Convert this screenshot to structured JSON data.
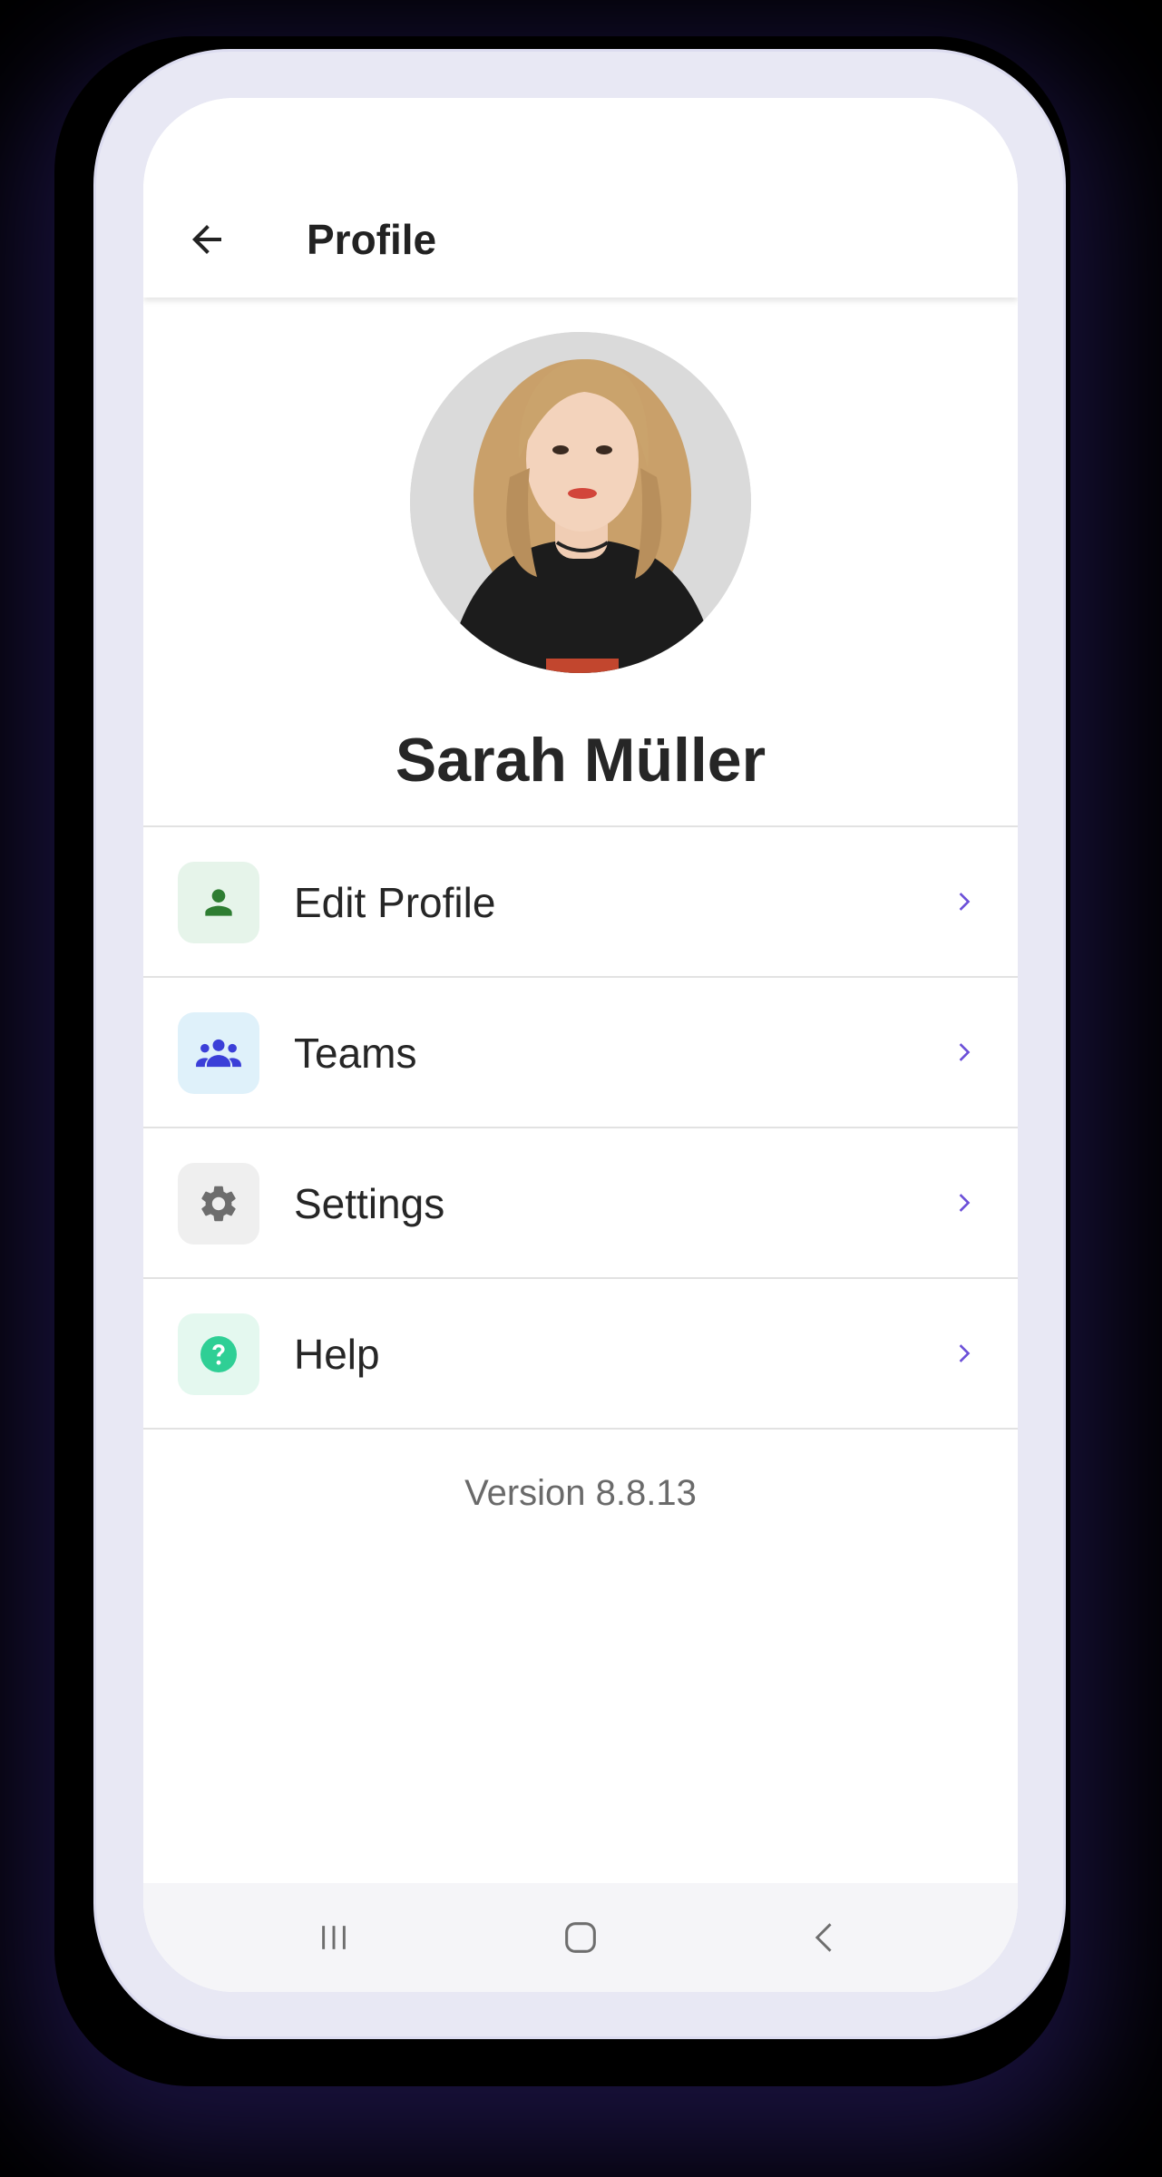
{
  "app_bar": {
    "title": "Profile",
    "back_icon": "arrow-left-icon"
  },
  "profile": {
    "name": "Sarah Müller",
    "avatar_alt": "Profile photo"
  },
  "menu": {
    "items": [
      {
        "label": "Edit Profile",
        "icon": "person-icon",
        "icon_color": "#2e7d32",
        "icon_bg": "#e6f4ea"
      },
      {
        "label": "Teams",
        "icon": "group-icon",
        "icon_color": "#3b3fd8",
        "icon_bg": "#dff1fa"
      },
      {
        "label": "Settings",
        "icon": "gear-icon",
        "icon_color": "#6d6d6d",
        "icon_bg": "#efefef"
      },
      {
        "label": "Help",
        "icon": "help-circle-icon",
        "icon_color": "#2fcf95",
        "icon_bg": "#e4f8ef"
      }
    ],
    "chevron_color": "#6b4fd8"
  },
  "footer": {
    "version": "Version 8.8.13"
  },
  "system_nav": {
    "recents_icon": "recent-apps-icon",
    "home_icon": "home-icon",
    "back_icon": "back-chevron-icon"
  },
  "colors": {
    "frame": "#e8e8f4",
    "accent": "#6b4fd8"
  }
}
